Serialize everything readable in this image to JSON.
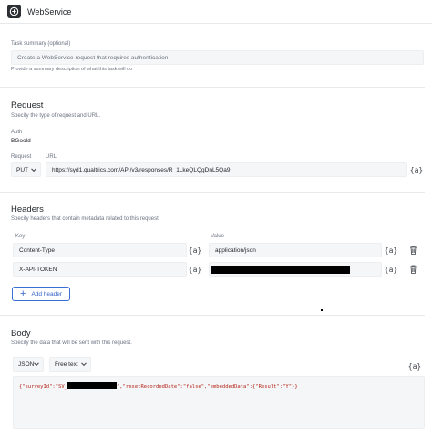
{
  "header": {
    "title": "WebService",
    "icon": "webservice-app-icon"
  },
  "task": {
    "label": "Task summary (optional)",
    "placeholder": "Create a WebService request that requires authentication",
    "hint": "Provide a summary description of what this task will do"
  },
  "request": {
    "title": "Request",
    "subtitle": "Specify the type of request and URL.",
    "auth_label": "Auth",
    "auth_value": "BGoold",
    "request_label": "Request",
    "method": "PUT",
    "url_label": "URL",
    "url_value": "https://syd1.qualtrics.com/API/v3/responses/R_1LkeQLQgDnL5Qa9",
    "piped_text": "{a}"
  },
  "headers": {
    "title": "Headers",
    "subtitle": "Specify headers that contain metadata related to this request.",
    "key_label": "Key",
    "value_label": "Value",
    "rows": [
      {
        "key": "Content-Type",
        "value": "application/json"
      },
      {
        "key": "X-API-TOKEN",
        "value": ""
      }
    ],
    "piped_text": "{a}",
    "add_label": "Add header"
  },
  "body": {
    "title": "Body",
    "subtitle": "Specify the data that will be sent with this request.",
    "format": "JSON",
    "mode": "Free text",
    "piped_text": "{a}",
    "code_before": "{\"surveyId\":\"SV_",
    "code_after": "\",\"resetRecordedDate\":\"false\",\"embeddedData\":{\"Result\":\"Y\"}}"
  },
  "colors": {
    "accent": "#2f5fc8",
    "code_text": "#b42318",
    "field_bg": "#f5f6f7"
  }
}
